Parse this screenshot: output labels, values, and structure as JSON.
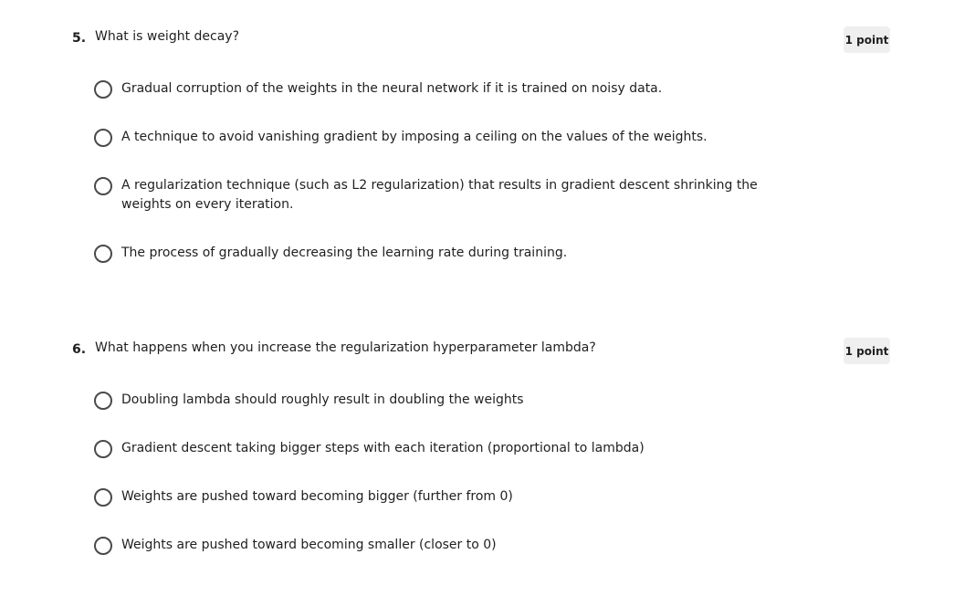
{
  "questions": [
    {
      "number": "5.",
      "prompt": "What is weight decay?",
      "points": "1 point",
      "options": [
        "Gradual corruption of the weights in the neural network if it is trained on noisy data.",
        "A technique to avoid vanishing gradient by imposing a ceiling on the values of the weights.",
        "A regularization technique (such as L2 regularization) that results in gradient descent shrinking the weights on every iteration.",
        "The process of gradually decreasing the learning rate during training."
      ]
    },
    {
      "number": "6.",
      "prompt": "What happens when you increase the regularization hyperparameter lambda?",
      "points": "1 point",
      "options": [
        "Doubling lambda should roughly result in doubling the weights",
        "Gradient descent taking bigger steps with each iteration (proportional to lambda)",
        "Weights are pushed toward becoming bigger (further from 0)",
        "Weights are pushed toward becoming smaller (closer to 0)"
      ]
    }
  ]
}
